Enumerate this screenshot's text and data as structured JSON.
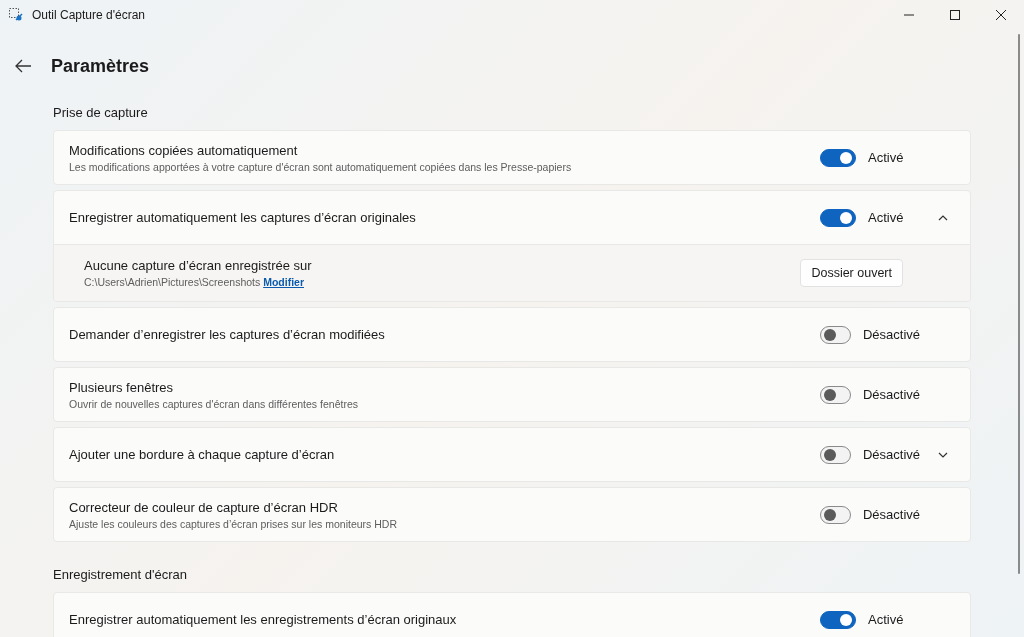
{
  "window": {
    "title": "Outil Capture d'écran"
  },
  "page": {
    "title": "Paramètres"
  },
  "sections": [
    {
      "title": "Prise de capture",
      "rows": [
        {
          "title": "Modifications copiées automatiquement",
          "description": "Les modifications apportées à votre capture d'écran sont automatiquement copiées dans les Presse-papiers",
          "on": true,
          "state_label": "Activé"
        },
        {
          "title": "Enregistrer automatiquement les captures d’écran originales",
          "on": true,
          "state_label": "Activé",
          "expanded": true,
          "detail": {
            "title": "Aucune capture d’écran enregistrée sur",
            "path": "C:\\Users\\Adrien\\Pictures\\Screenshots",
            "link": "Modifier",
            "button": "Dossier ouvert"
          }
        },
        {
          "title": "Demander d’enregistrer les captures d’écran modifiées",
          "on": false,
          "state_label": "Désactivé"
        },
        {
          "title": "Plusieurs fenêtres",
          "description": "Ouvrir de nouvelles captures d'écran dans différentes fenêtres",
          "on": false,
          "state_label": "Désactivé"
        },
        {
          "title": "Ajouter une bordure à chaque capture d’écran",
          "on": false,
          "state_label": "Désactivé",
          "expanded": false
        },
        {
          "title": "Correcteur de couleur de capture d’écran HDR",
          "description": "Ajuste les couleurs des captures d’écran prises sur les moniteurs HDR",
          "on": false,
          "state_label": "Désactivé"
        }
      ]
    },
    {
      "title": "Enregistrement d'écran",
      "rows": [
        {
          "title": "Enregistrer automatiquement les enregistrements d’écran originaux",
          "on": true,
          "state_label": "Activé"
        }
      ]
    }
  ]
}
